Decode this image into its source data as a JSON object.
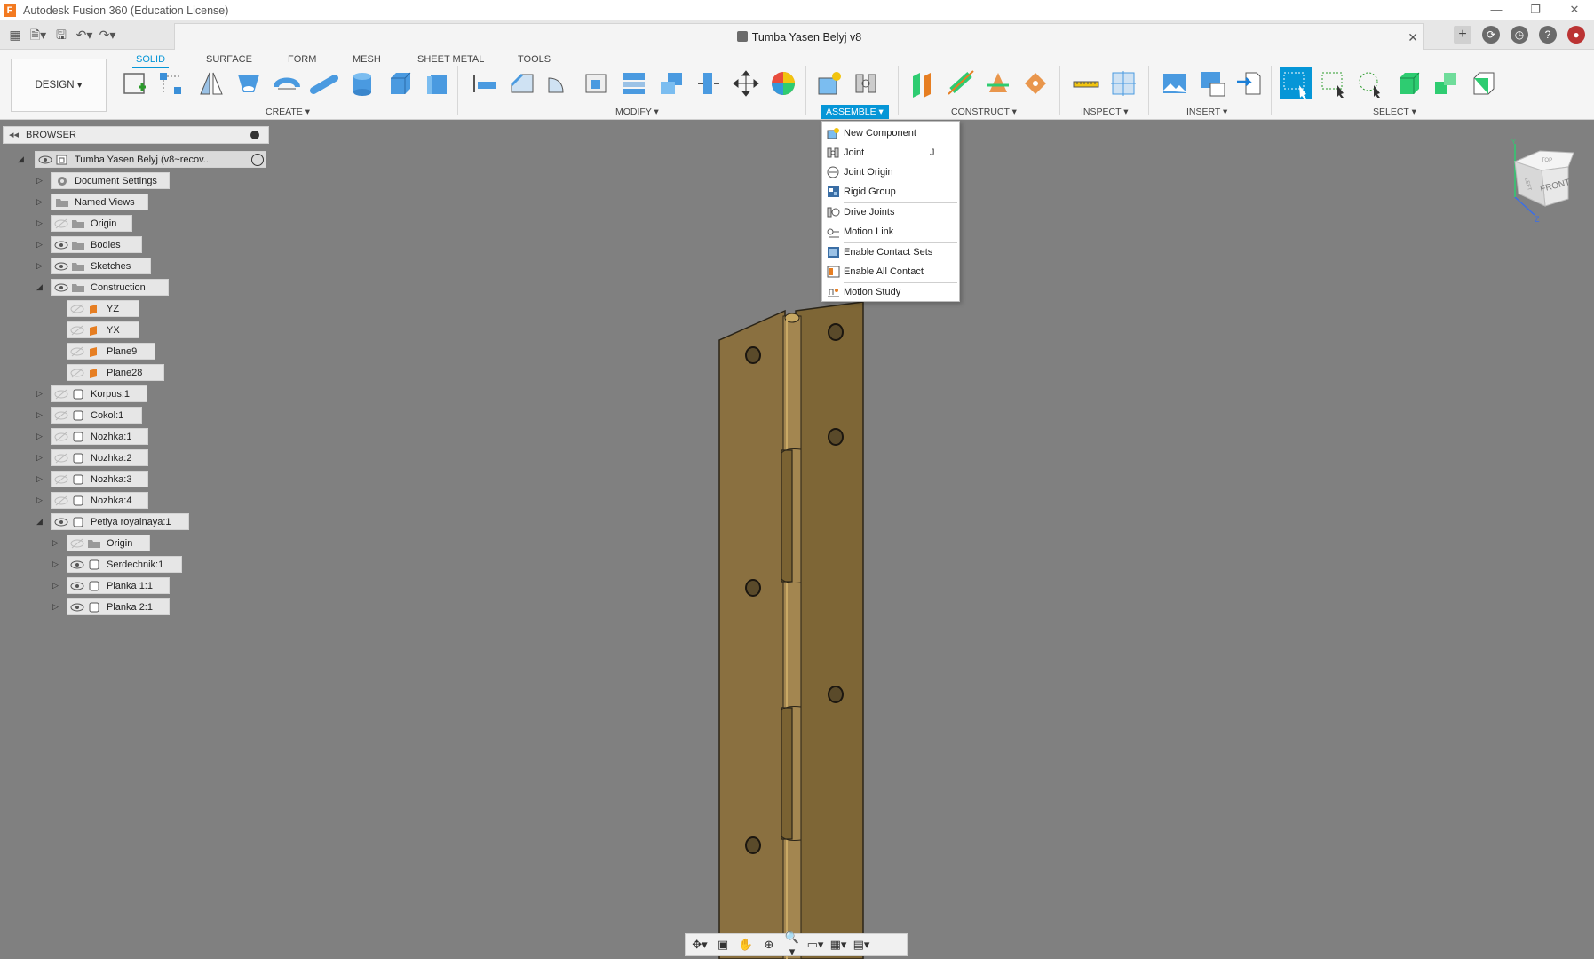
{
  "window": {
    "title": "Autodesk Fusion 360 (Education License)",
    "minimize": "—",
    "restore": "❐",
    "close": "✕"
  },
  "document_tab": {
    "name": "Tumba Yasen Belyj v8",
    "close": "✕"
  },
  "workspace_button": "DESIGN ▾",
  "workspace_tabs": [
    "SOLID",
    "SURFACE",
    "FORM",
    "MESH",
    "SHEET METAL",
    "TOOLS"
  ],
  "active_tab": "SOLID",
  "panels": {
    "create": "CREATE ▾",
    "modify": "MODIFY ▾",
    "assemble": "ASSEMBLE ▾",
    "construct": "CONSTRUCT ▾",
    "inspect": "INSPECT ▾",
    "insert": "INSERT ▾",
    "select": "SELECT ▾"
  },
  "browser": {
    "title": "BROWSER",
    "collapse": "◂◂",
    "root": "Tumba Yasen Belyj (v8~recov...",
    "items": {
      "document_settings": "Document Settings",
      "named_views": "Named Views",
      "origin": "Origin",
      "bodies": "Bodies",
      "sketches": "Sketches",
      "construction": "Construction",
      "yz": "YZ",
      "yx": "YX",
      "plane9": "Plane9",
      "plane28": "Plane28",
      "korpus": "Korpus:1",
      "cokol": "Cokol:1",
      "nozhka1": "Nozhka:1",
      "nozhka2": "Nozhka:2",
      "nozhka3": "Nozhka:3",
      "nozhka4": "Nozhka:4",
      "petlya": "Petlya royalnaya:1",
      "petlya_origin": "Origin",
      "serdechnik": "Serdechnik:1",
      "planka1": "Planka 1:1",
      "planka2": "Planka 2:1"
    }
  },
  "assemble_menu": {
    "new_component": "New Component",
    "joint": "Joint",
    "joint_key": "J",
    "joint_origin": "Joint Origin",
    "rigid_group": "Rigid Group",
    "drive_joints": "Drive Joints",
    "motion_link": "Motion Link",
    "enable_contact_sets": "Enable Contact Sets",
    "enable_all_contact": "Enable All Contact",
    "motion_study": "Motion Study"
  },
  "viewcube": {
    "front": "FRONT",
    "top": "TOP",
    "left": "LEFT",
    "z": "Z",
    "y": "Y"
  },
  "colors": {
    "accent": "#0696d7",
    "canvas": "#808080",
    "hinge": "#8a7040"
  }
}
